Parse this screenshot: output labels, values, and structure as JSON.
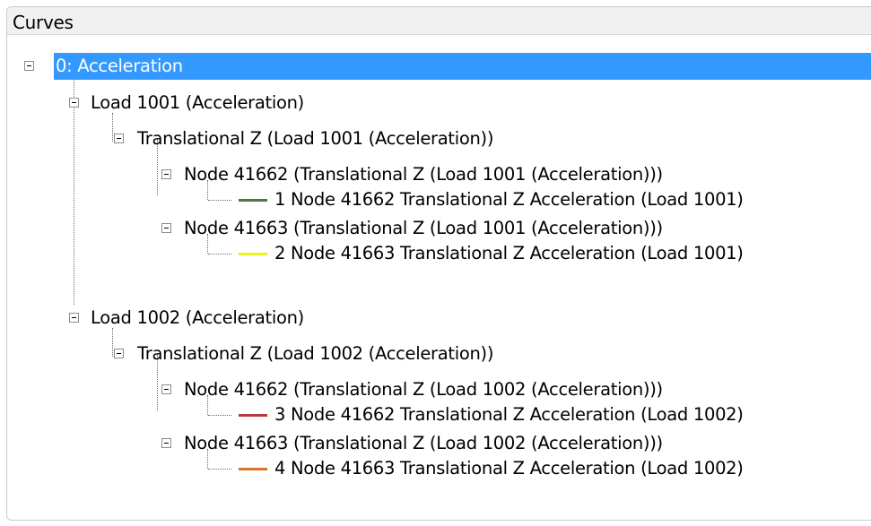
{
  "panel": {
    "title": "Curves"
  },
  "tree": {
    "root": {
      "label": "0: Acceleration"
    },
    "load1001": {
      "label": "Load 1001 (Acceleration)",
      "translational": {
        "label": "Translational Z (Load 1001 (Acceleration))"
      },
      "node41662": {
        "label": "Node 41662 (Translational Z (Load 1001 (Acceleration)))"
      },
      "curve1": {
        "label": "1 Node 41662 Translational Z Acceleration (Load 1001)",
        "color": "#4f7a3a"
      },
      "node41663": {
        "label": "Node 41663 (Translational Z (Load 1001 (Acceleration)))"
      },
      "curve2": {
        "label": "2 Node 41663 Translational Z Acceleration (Load 1001)",
        "color": "#e8f21c"
      }
    },
    "load1002": {
      "label": "Load 1002 (Acceleration)",
      "translational": {
        "label": "Translational Z (Load 1002 (Acceleration))"
      },
      "node41662": {
        "label": "Node 41662 (Translational Z (Load 1002 (Acceleration)))"
      },
      "curve3": {
        "label": "3 Node 41662 Translational Z Acceleration (Load 1002)",
        "color": "#b5393f"
      },
      "node41663": {
        "label": "Node 41663 (Translational Z (Load 1002 (Acceleration)))"
      },
      "curve4": {
        "label": "4 Node 41663 Translational Z Acceleration (Load 1002)",
        "color": "#d9732a"
      }
    }
  }
}
